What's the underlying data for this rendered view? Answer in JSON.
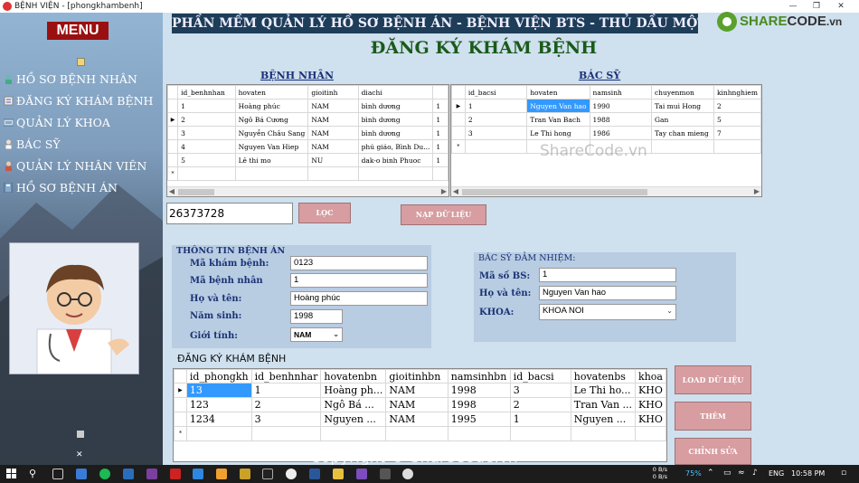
{
  "window": {
    "title": "BỆNH VIỆN - [phongkhambenh]"
  },
  "sidebar": {
    "menu_label": "MENU",
    "items": [
      {
        "label": "HỒ SƠ BỆNH NHÂN",
        "icon": "patient-icon"
      },
      {
        "label": "ĐĂNG KÝ KHÁM BỆNH",
        "icon": "register-icon"
      },
      {
        "label": "QUẢN LÝ KHOA",
        "icon": "department-icon"
      },
      {
        "label": "BÁC SỸ",
        "icon": "doctor-icon"
      },
      {
        "label": "QUẢN LÝ NHÂN VIÊN",
        "icon": "staff-icon"
      },
      {
        "label": "HỒ SƠ BỆNH ÁN",
        "icon": "record-icon"
      }
    ]
  },
  "banner": "PHẦN MỀM QUẢN LÝ HỒ SƠ BỆNH ÁN - BỆNH VIỆN BTS - THỦ DẦU MỘT",
  "logo": {
    "brand_green": "SHARE",
    "brand_dark": "CODE",
    "suffix": ".vn"
  },
  "form_title": "ĐĂNG KÝ KHÁM BỆNH",
  "patients": {
    "title": "BỆNH NHÂN",
    "columns": [
      "id_benhnhan",
      "hovaten",
      "gioitinh",
      "diachi",
      ""
    ],
    "rows": [
      [
        "1",
        "Hoàng phúc",
        "NAM",
        "bình dương",
        "1"
      ],
      [
        "2",
        "Ngô Bá Cương",
        "NAM",
        "bình dương",
        "1"
      ],
      [
        "3",
        "Nguyễn Châu Sang",
        "NAM",
        "bình dương",
        "1"
      ],
      [
        "4",
        "Nguyen Van Hiep",
        "NAM",
        "phú giáo, Bình Du...",
        "1"
      ],
      [
        "5",
        "Lê thi mo",
        "NU",
        "dak-o binh Phuoc",
        "1"
      ]
    ]
  },
  "doctors": {
    "title": "BÁC SỸ",
    "columns": [
      "id_bacsi",
      "hovaten",
      "namsinh",
      "chuyenmon",
      "kinhnghiem"
    ],
    "rows": [
      [
        "1",
        "Nguyen Van hao",
        "1990",
        "Tai mui Hong",
        "2"
      ],
      [
        "2",
        "Tran Van Bach",
        "1988",
        "Gan",
        "5"
      ],
      [
        "3",
        "Le Thi hong",
        "1986",
        "Tay chan mieng",
        "7"
      ]
    ]
  },
  "filter": {
    "value": "26373728",
    "filter_label": "LỌC",
    "load_label": "NẠP DỮ LIỆU"
  },
  "record_panel": {
    "title": "THÔNG TIN BỆNH ÁN",
    "fields": [
      {
        "label": "Mã khám bệnh:",
        "value": "0123"
      },
      {
        "label": "Mã bệnh nhân",
        "value": "1"
      },
      {
        "label": "Họ và tên:",
        "value": "Hoàng phúc"
      },
      {
        "label": "Năm sinh:",
        "value": "1998"
      },
      {
        "label": "Giới tính:",
        "value": "NAM"
      }
    ]
  },
  "doctor_panel": {
    "title": "BÁC SỸ ĐẢM NHIỆM:",
    "fields": [
      {
        "label": "Mã số BS:",
        "value": "1"
      },
      {
        "label": "Họ và tên:",
        "value": "Nguyen Van hao"
      },
      {
        "label": "KHOA:",
        "value": "KHOA NOI"
      }
    ]
  },
  "registrations": {
    "title": "ĐĂNG KÝ KHÁM BỆNH",
    "columns": [
      "id_phongkh",
      "id_benhnhar",
      "hovatenbn",
      "gioitinhbn",
      "namsinhbn",
      "id_bacsi",
      "hovatenbs",
      "khoa"
    ],
    "rows": [
      [
        "13",
        "1",
        "Hoàng ph...",
        "NAM",
        "1998",
        "3",
        "Le Thi ho...",
        "KHO"
      ],
      [
        "123",
        "2",
        "Ngô Bá ...",
        "NAM",
        "1998",
        "2",
        "Tran Van ...",
        "KHO"
      ],
      [
        "1234",
        "3",
        "Nguyen ...",
        "NAM",
        "1995",
        "1",
        "Nguyen ...",
        "KHO"
      ]
    ]
  },
  "actions": {
    "load": "LOAD DỮ LIỆU",
    "add": "THÊM",
    "edit": "CHỈNH SỬA"
  },
  "watermark": "Copyright © ShareCode.vn",
  "watermark_center": "ShareCode.vn",
  "taskbar": {
    "net_up": "0 B/s",
    "net_down": "0 B/s",
    "battery": "75%",
    "lang": "ENG",
    "time": "10:58 PM"
  },
  "colors": {
    "banner": "#1d3d58",
    "menu": "#9a1010",
    "button": "#d79da1",
    "panel": "#b8cce2",
    "selection": "#3399ff"
  }
}
